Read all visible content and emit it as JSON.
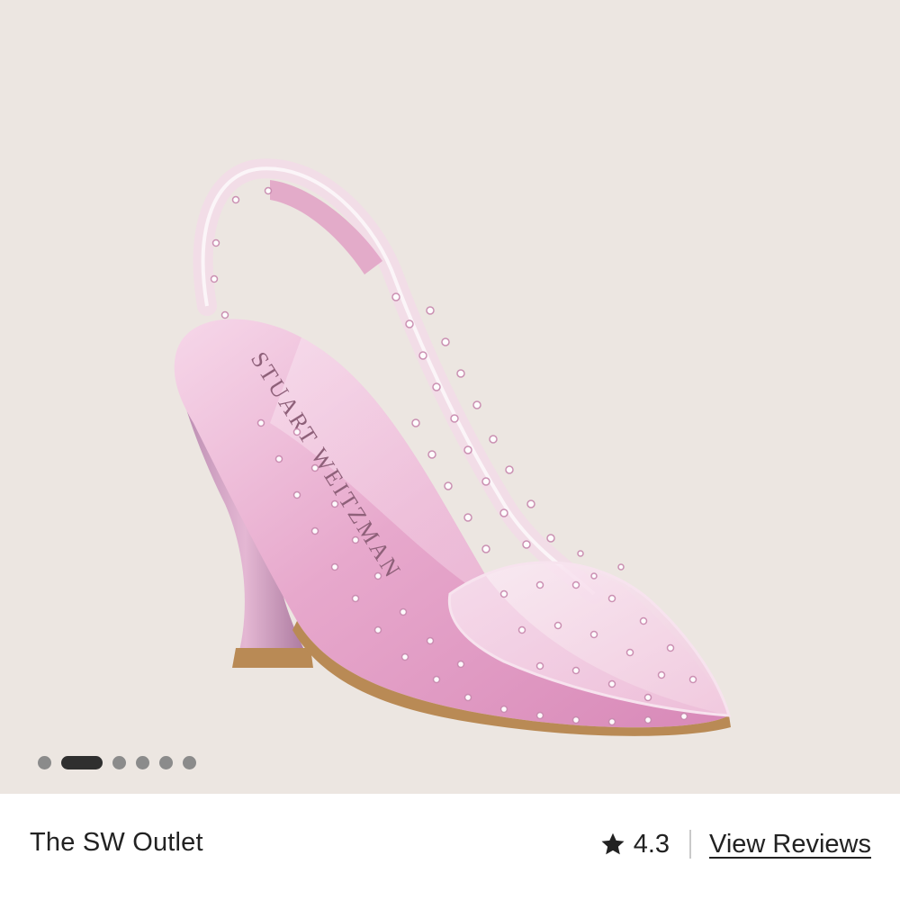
{
  "gallery": {
    "image_subject": "pink-clear-slingback-pump-icon",
    "insole_brand_text": "STUART WEITZMAN",
    "dots_count": 6,
    "active_dot_index": 1
  },
  "footer": {
    "store_name": "The SW Outlet",
    "rating": "4.3",
    "view_reviews_label": "View Reviews"
  },
  "colors": {
    "background": "#ece6e1",
    "text": "#222222",
    "dot_inactive": "#8b8b8b",
    "dot_active": "#2f2f2f"
  }
}
